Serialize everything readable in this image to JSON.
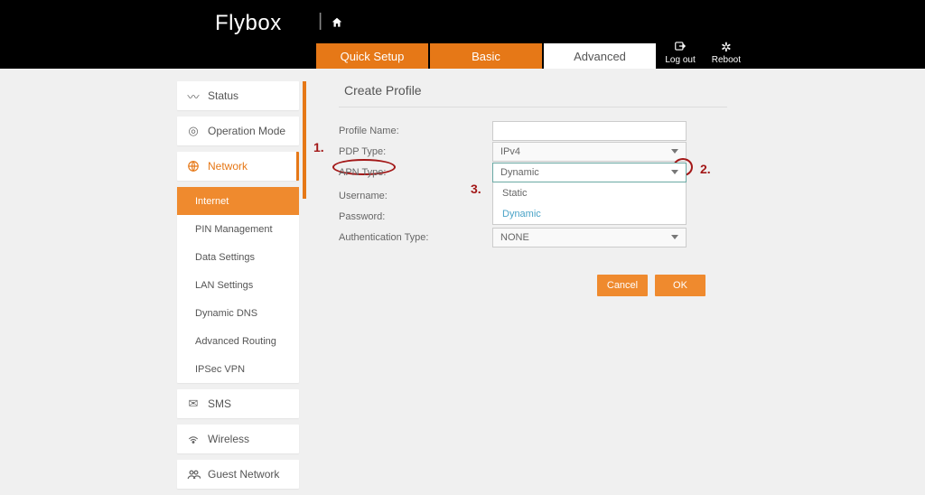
{
  "brand": "Flybox",
  "tabs": {
    "quick": "Quick Setup",
    "basic": "Basic",
    "advanced": "Advanced"
  },
  "header_actions": {
    "logout": "Log out",
    "reboot": "Reboot"
  },
  "sidebar": {
    "status": "Status",
    "operation_mode": "Operation Mode",
    "network": "Network",
    "sub": {
      "internet": "Internet",
      "pin": "PIN Management",
      "data": "Data Settings",
      "lan": "LAN Settings",
      "ddns": "Dynamic DNS",
      "routing": "Advanced Routing",
      "ipsec": "IPSec VPN"
    },
    "sms": "SMS",
    "wireless": "Wireless",
    "guest": "Guest Network"
  },
  "form": {
    "title": "Create Profile",
    "labels": {
      "profile_name": "Profile Name:",
      "pdp_type": "PDP Type:",
      "apn_type": "APN Type:",
      "username": "Username:",
      "password": "Password:",
      "auth_type": "Authentication Type:"
    },
    "values": {
      "pdp_type": "IPv4",
      "apn_type": "Dynamic",
      "auth_type": "NONE"
    },
    "apn_options": {
      "static": "Static",
      "dynamic": "Dynamic"
    },
    "buttons": {
      "cancel": "Cancel",
      "ok": "OK"
    }
  },
  "annotations": {
    "a1": "1.",
    "a2": "2.",
    "a3": "3."
  }
}
